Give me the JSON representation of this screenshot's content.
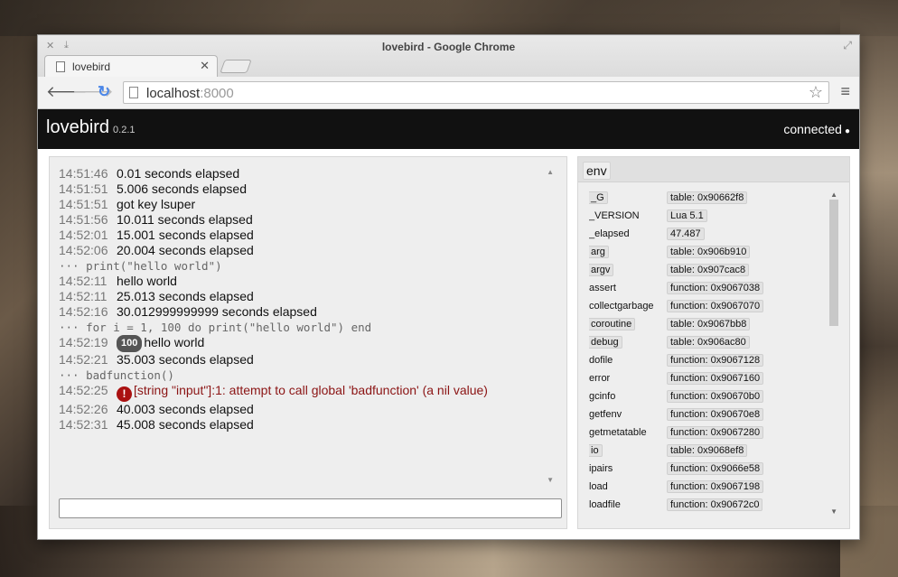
{
  "browser": {
    "window_title": "lovebird - Google Chrome",
    "tab_label": "lovebird",
    "url_host": "localhost",
    "url_port": ":8000"
  },
  "app": {
    "title": "lovebird",
    "version": "0.2.1",
    "status": "connected"
  },
  "console": {
    "lines": [
      {
        "ts": "14:51:46",
        "text": "0.01 seconds elapsed"
      },
      {
        "ts": "14:51:51",
        "text": "5.006 seconds elapsed"
      },
      {
        "ts": "14:51:51",
        "text": "got key lsuper"
      },
      {
        "ts": "14:51:56",
        "text": "10.011 seconds elapsed"
      },
      {
        "ts": "14:52:01",
        "text": "15.001 seconds elapsed"
      },
      {
        "ts": "14:52:06",
        "text": "20.004 seconds elapsed"
      },
      {
        "cmd": "··· print(\"hello world\")"
      },
      {
        "ts": "14:52:11",
        "text": "hello world"
      },
      {
        "ts": "14:52:11",
        "text": "25.013 seconds elapsed"
      },
      {
        "ts": "14:52:16",
        "text": "30.012999999999 seconds elapsed"
      },
      {
        "cmd": "··· for i = 1, 100 do print(\"hello world\") end"
      },
      {
        "ts": "14:52:19",
        "badge": "100",
        "text": "hello world"
      },
      {
        "ts": "14:52:21",
        "text": "35.003 seconds elapsed"
      },
      {
        "cmd": "··· badfunction()"
      },
      {
        "ts": "14:52:25",
        "error": true,
        "text": "[string \"input\"]:1: attempt to call global 'badfunction' (a nil value)"
      },
      {
        "ts": "14:52:26",
        "text": "40.003 seconds elapsed"
      },
      {
        "ts": "14:52:31",
        "text": "45.008 seconds elapsed"
      }
    ],
    "input_value": ""
  },
  "env": {
    "title": "env",
    "rows": [
      {
        "key": "_G",
        "boxed": true,
        "value": "table: 0x90662f8"
      },
      {
        "key": "_VERSION",
        "boxed": false,
        "value": "Lua 5.1"
      },
      {
        "key": "_elapsed",
        "boxed": false,
        "value": "47.487"
      },
      {
        "key": "arg",
        "boxed": true,
        "value": "table: 0x906b910"
      },
      {
        "key": "argv",
        "boxed": true,
        "value": "table: 0x907cac8"
      },
      {
        "key": "assert",
        "boxed": false,
        "value": "function: 0x9067038"
      },
      {
        "key": "collectgarbage",
        "boxed": false,
        "value": "function: 0x9067070"
      },
      {
        "key": "coroutine",
        "boxed": true,
        "value": "table: 0x9067bb8"
      },
      {
        "key": "debug",
        "boxed": true,
        "value": "table: 0x906ac80"
      },
      {
        "key": "dofile",
        "boxed": false,
        "value": "function: 0x9067128"
      },
      {
        "key": "error",
        "boxed": false,
        "value": "function: 0x9067160"
      },
      {
        "key": "gcinfo",
        "boxed": false,
        "value": "function: 0x90670b0"
      },
      {
        "key": "getfenv",
        "boxed": false,
        "value": "function: 0x90670e8"
      },
      {
        "key": "getmetatable",
        "boxed": false,
        "value": "function: 0x9067280"
      },
      {
        "key": "io",
        "boxed": true,
        "value": "table: 0x9068ef8"
      },
      {
        "key": "ipairs",
        "boxed": false,
        "value": "function: 0x9066e58"
      },
      {
        "key": "load",
        "boxed": false,
        "value": "function: 0x9067198"
      },
      {
        "key": "loadfile",
        "boxed": false,
        "value": "function: 0x90672c0"
      }
    ]
  },
  "icons": {
    "close": "✕",
    "download": "⤓",
    "maximize": "⤢",
    "back": "🡐",
    "forward": "🡒",
    "reload": "↻",
    "star": "☆",
    "menu": "≡",
    "scroll_up": "▲",
    "scroll_down": "▼",
    "status_dot": "●",
    "error": "!"
  }
}
